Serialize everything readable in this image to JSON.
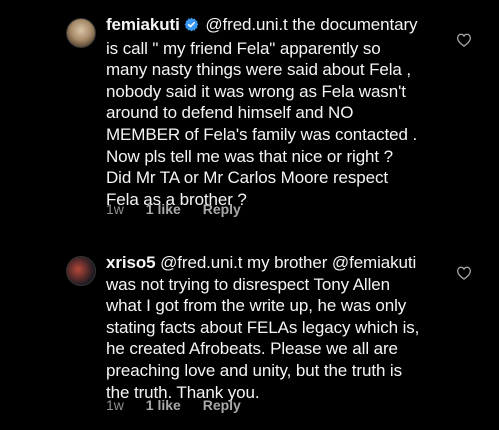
{
  "comments": [
    {
      "username": "femiakuti",
      "verified": true,
      "lines": [
        "@fred.uni.t the documentary",
        "is call \" my friend Fela\" apparently so",
        "many nasty things were said about Fela ,",
        "nobody said it was wrong as Fela wasn't",
        "around to defend himself and NO",
        "MEMBER of Fela's family was contacted .",
        "Now pls tell me was that nice or right ?",
        "Did Mr TA or Mr Carlos Moore respect",
        "Fela as a brother ?"
      ],
      "time": "1w",
      "likes": "1 like",
      "reply": "Reply",
      "avatar_icon": "profile-photo-icon",
      "like_icon": "heart-outline-icon"
    },
    {
      "username": "xriso5",
      "verified": false,
      "lines": [
        "@fred.uni.t my brother @femiakuti",
        "was not trying to disrespect Tony Allen",
        "what I got from the write up, he was only",
        "stating facts about FELAs legacy which is,",
        "he created Afrobeats. Please we all are",
        "preaching love and unity, but the truth is",
        "the truth. Thank you."
      ],
      "time": "1w",
      "likes": "1 like",
      "reply": "Reply",
      "avatar_icon": "profile-photo-icon",
      "like_icon": "heart-outline-icon"
    }
  ],
  "colors": {
    "background": "#000000",
    "text": "#f5f5f5",
    "meta": "#8e8e8e",
    "verified_badge": "#3897f0"
  }
}
